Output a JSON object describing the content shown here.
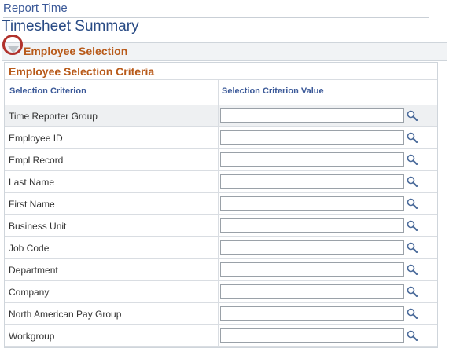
{
  "breadcrumb": "Report Time",
  "page_title": "Timesheet Summary",
  "section": {
    "title": "Employee Selection",
    "toggle_icon": "collapse-triangle-icon"
  },
  "criteria": {
    "title": "Employee Selection Criteria",
    "columns": [
      "Selection Criterion",
      "Selection Criterion Value"
    ],
    "rows": [
      {
        "label": "Time Reporter Group",
        "value": ""
      },
      {
        "label": "Employee ID",
        "value": ""
      },
      {
        "label": "Empl Record",
        "value": ""
      },
      {
        "label": "Last Name",
        "value": ""
      },
      {
        "label": "First Name",
        "value": ""
      },
      {
        "label": "Business Unit",
        "value": ""
      },
      {
        "label": "Job Code",
        "value": ""
      },
      {
        "label": "Department",
        "value": ""
      },
      {
        "label": "Company",
        "value": ""
      },
      {
        "label": "North American Pay Group",
        "value": ""
      },
      {
        "label": "Workgroup",
        "value": ""
      }
    ],
    "lookup_icon": "magnifier-lookup-icon"
  },
  "colors": {
    "link_blue": "#3b5998",
    "title_blue": "#284a84",
    "section_orange": "#b85a1a",
    "highlight_red": "#b1322c"
  }
}
